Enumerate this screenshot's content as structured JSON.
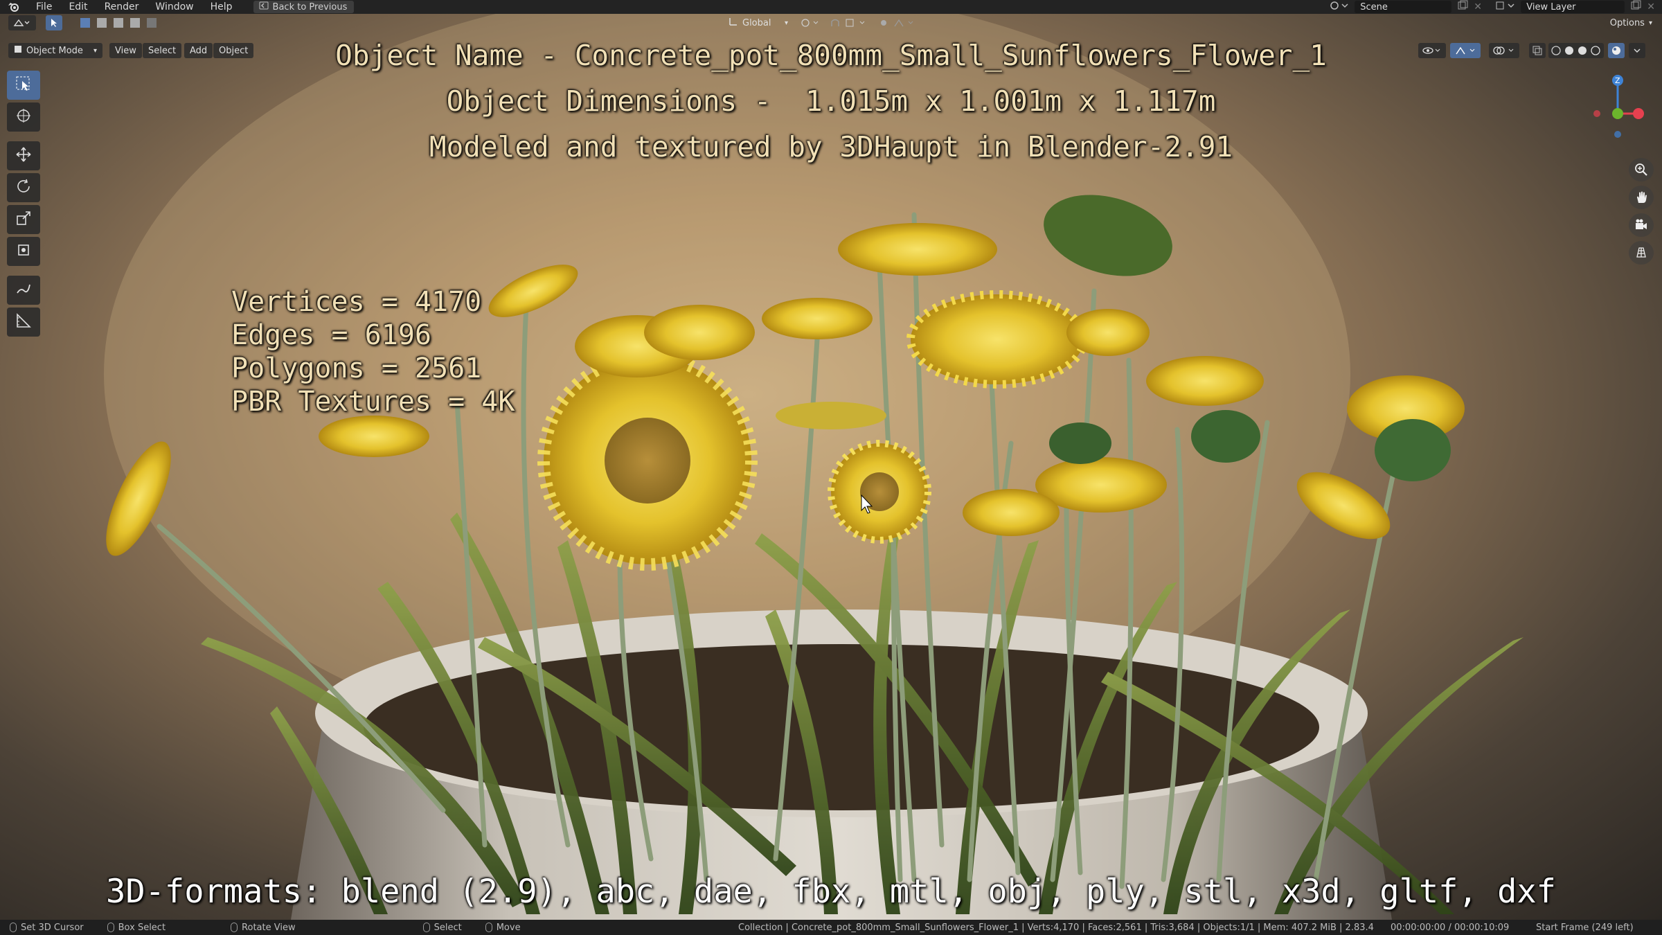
{
  "menubar": {
    "items": [
      "File",
      "Edit",
      "Render",
      "Window",
      "Help"
    ],
    "back_label": "Back to Previous",
    "scene_label": "Scene",
    "view_layer_label": "View Layer"
  },
  "viewport_header": {
    "mode_label": "Object Mode",
    "menus": [
      "View",
      "Select",
      "Add",
      "Object"
    ],
    "orientation_label": "Global",
    "options_label": "Options"
  },
  "overlay": {
    "title": "Object Name - Concrete_pot_800mm_Small_Sunflowers_Flower_1",
    "dimensions": "Object Dimensions -  1.015m x 1.001m x 1.117m",
    "credit": "Modeled and textured by 3DHaupt in Blender-2.91",
    "stats": {
      "vertices": "Vertices = 4170",
      "edges": "Edges = 6196",
      "polygons": "Polygons = 2561",
      "textures": "PBR Textures = 4K"
    },
    "formats": "3D-formats: blend (2.9), abc, dae, fbx, mtl, obj, ply, stl, x3d, gltf, dxf"
  },
  "gizmo": {
    "z_label": "Z",
    "y_label": "Y",
    "x_label": "X"
  },
  "statusbar": {
    "set_cursor": "Set 3D Cursor",
    "box_select": "Box Select",
    "rotate_view": "Rotate View",
    "select": "Select",
    "move": "Move",
    "info": "Collection | Concrete_pot_800mm_Small_Sunflowers_Flower_1 | Verts:4,170 | Faces:2,561 | Tris:3,684 | Objects:1/1 | Mem: 407.2 MiB | 2.83.4",
    "time": "00:00:00:00 / 00:00:10:09",
    "frame": "Start Frame (249 left)"
  },
  "colors": {
    "accent": "#4d6c9a",
    "overlay_text": "#f1e0b6",
    "axis_x": "#e6404f",
    "axis_y": "#6cb52c",
    "axis_z": "#3e83d6"
  }
}
